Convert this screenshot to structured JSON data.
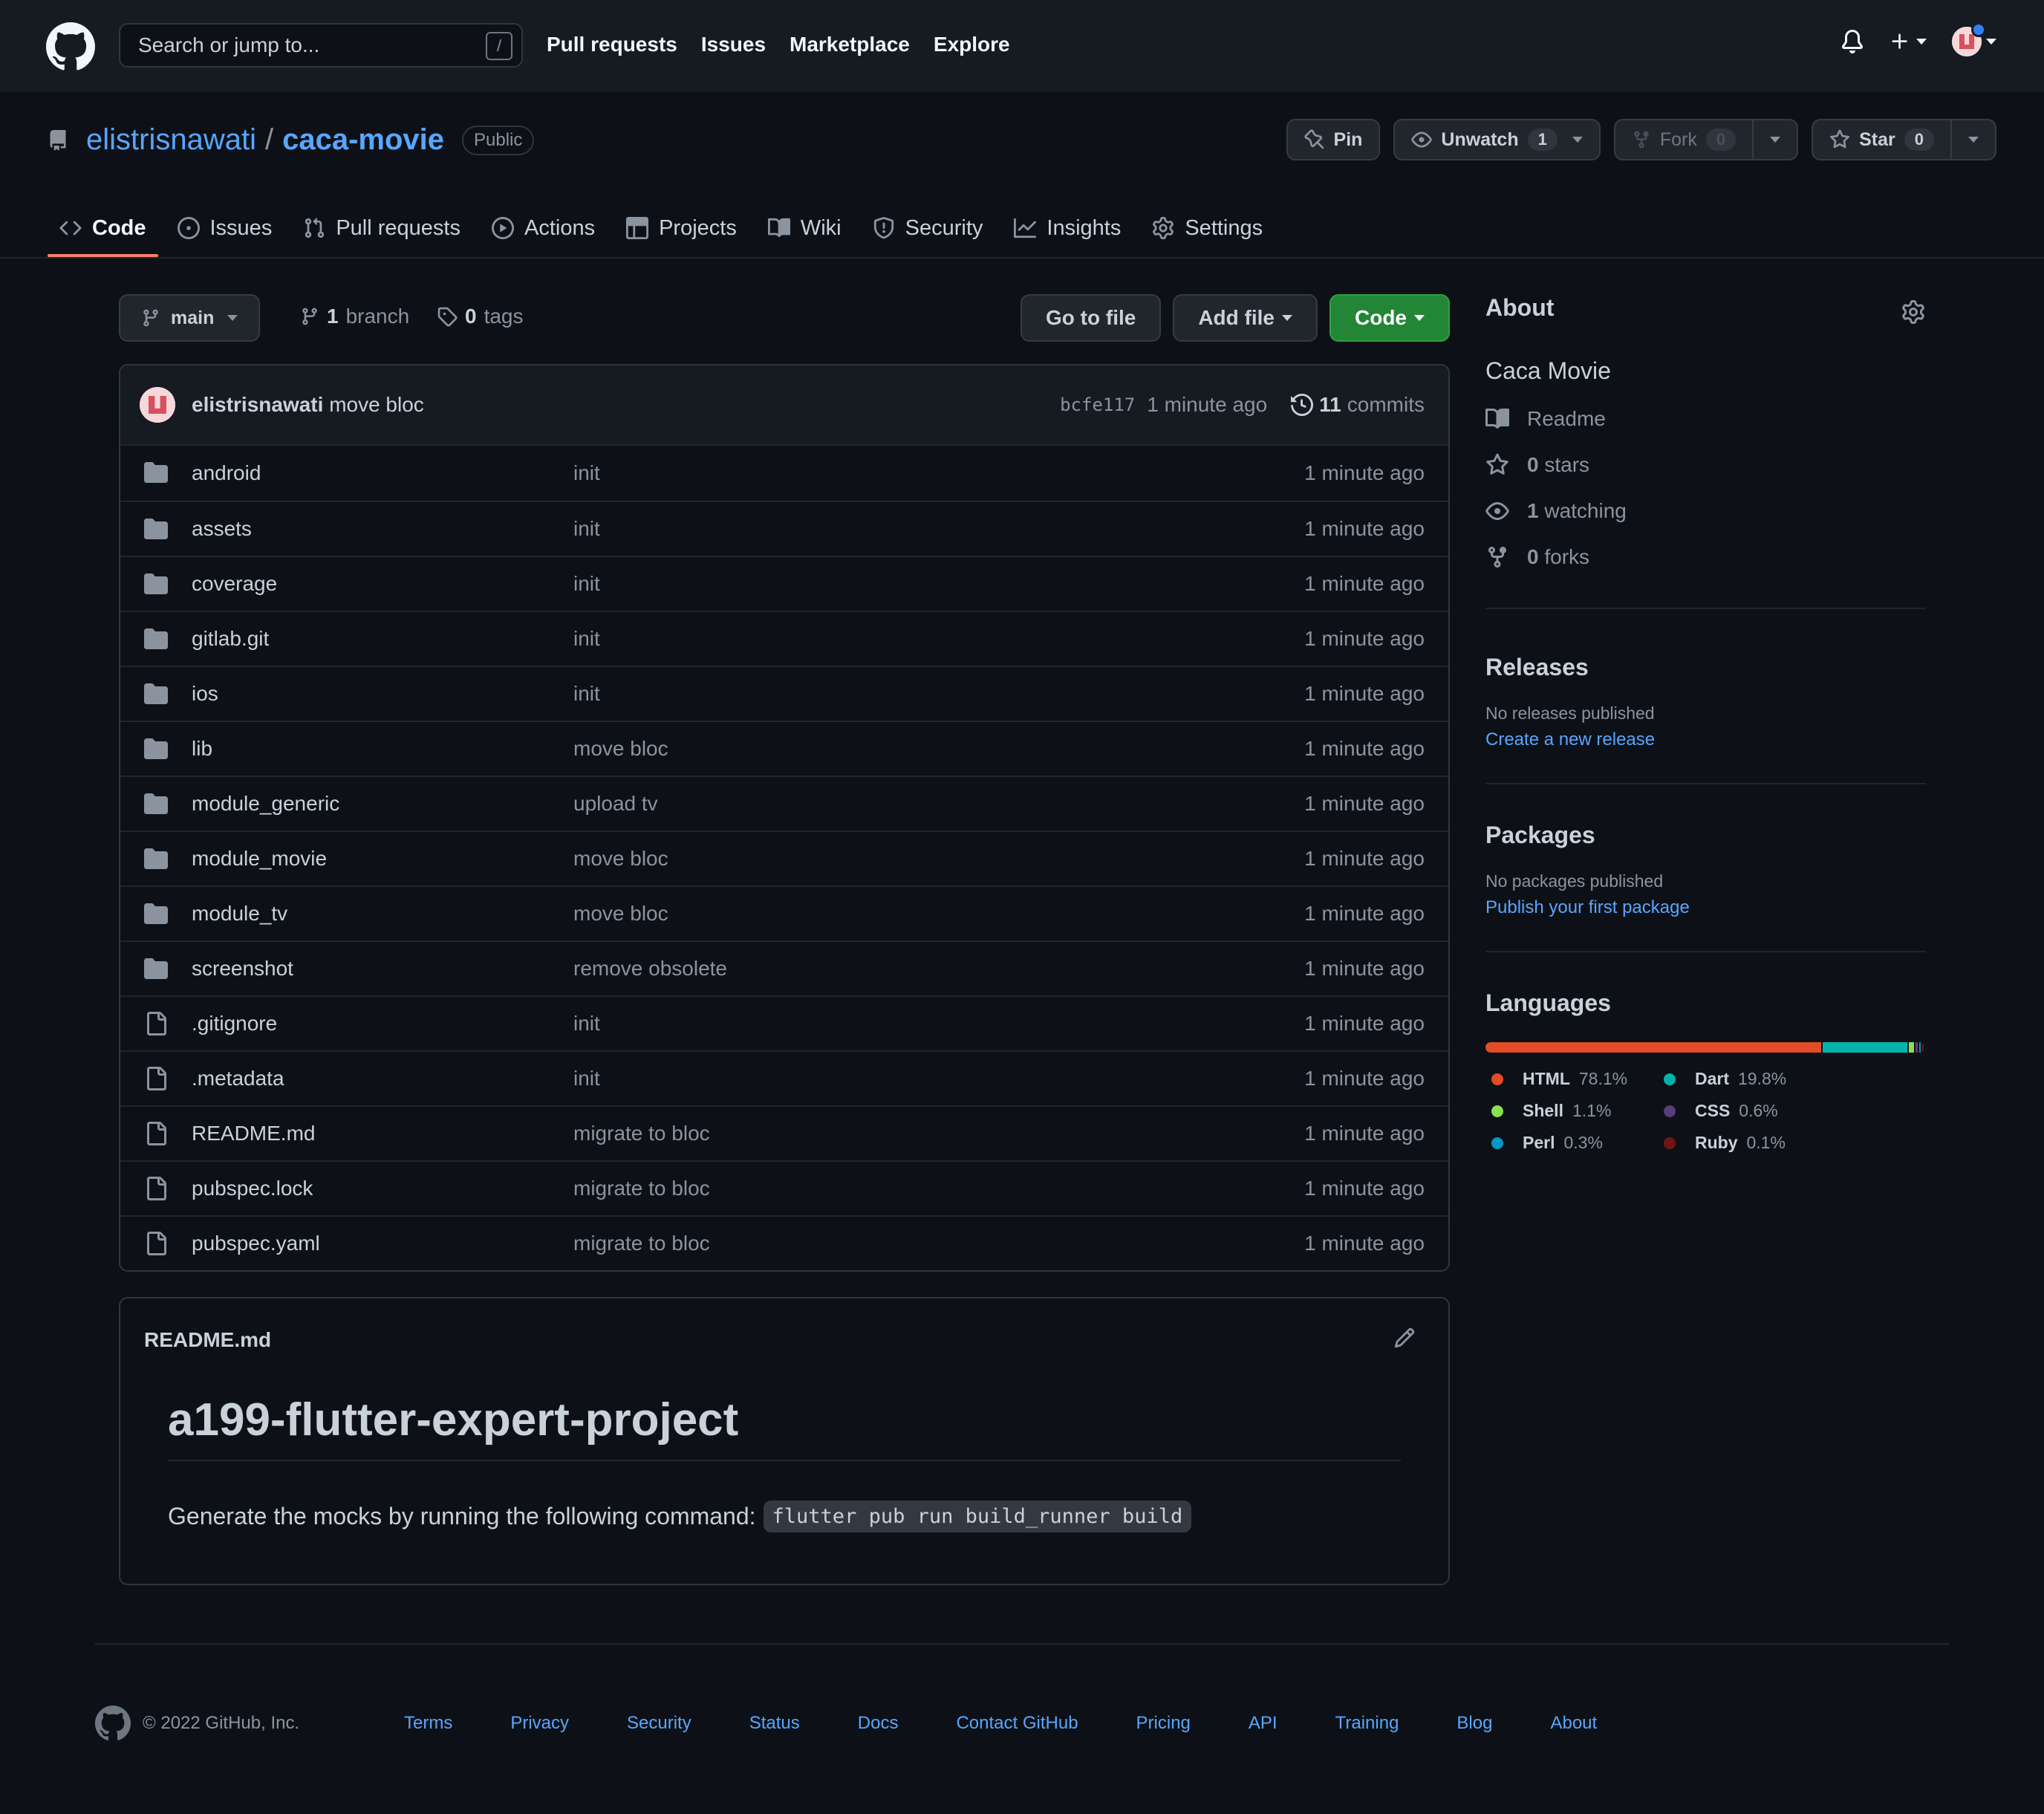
{
  "topbar": {
    "search_placeholder": "Search or jump to...",
    "search_shortcut": "/",
    "nav": [
      "Pull requests",
      "Issues",
      "Marketplace",
      "Explore"
    ]
  },
  "repo": {
    "owner": "elistrisnawati",
    "separator": "/",
    "name": "caca-movie",
    "visibility": "Public",
    "actions": {
      "pin": "Pin",
      "unwatch": "Unwatch",
      "watch_count": "1",
      "fork": "Fork",
      "fork_count": "0",
      "star": "Star",
      "star_count": "0"
    },
    "tabs": [
      "Code",
      "Issues",
      "Pull requests",
      "Actions",
      "Projects",
      "Wiki",
      "Security",
      "Insights",
      "Settings"
    ],
    "active_tab": "Code"
  },
  "toolbar": {
    "branch": "main",
    "branches_count": "1",
    "branches_label": "branch",
    "tags_count": "0",
    "tags_label": "tags",
    "go_to_file": "Go to file",
    "add_file": "Add file",
    "code": "Code"
  },
  "latest_commit": {
    "author": "elistrisnawati",
    "message": "move bloc",
    "sha": "bcfe117",
    "time": "1 minute ago",
    "commits_count": "11",
    "commits_label": "commits"
  },
  "files": [
    {
      "name": "android",
      "type": "dir",
      "message": "init",
      "age": "1 minute ago"
    },
    {
      "name": "assets",
      "type": "dir",
      "message": "init",
      "age": "1 minute ago"
    },
    {
      "name": "coverage",
      "type": "dir",
      "message": "init",
      "age": "1 minute ago"
    },
    {
      "name": "gitlab.git",
      "type": "dir",
      "message": "init",
      "age": "1 minute ago"
    },
    {
      "name": "ios",
      "type": "dir",
      "message": "init",
      "age": "1 minute ago"
    },
    {
      "name": "lib",
      "type": "dir",
      "message": "move bloc",
      "age": "1 minute ago"
    },
    {
      "name": "module_generic",
      "type": "dir",
      "message": "upload tv",
      "age": "1 minute ago"
    },
    {
      "name": "module_movie",
      "type": "dir",
      "message": "move bloc",
      "age": "1 minute ago"
    },
    {
      "name": "module_tv",
      "type": "dir",
      "message": "move bloc",
      "age": "1 minute ago"
    },
    {
      "name": "screenshot",
      "type": "dir",
      "message": "remove obsolete",
      "age": "1 minute ago"
    },
    {
      "name": ".gitignore",
      "type": "file",
      "message": "init",
      "age": "1 minute ago"
    },
    {
      "name": ".metadata",
      "type": "file",
      "message": "init",
      "age": "1 minute ago"
    },
    {
      "name": "README.md",
      "type": "file",
      "message": "migrate to bloc",
      "age": "1 minute ago"
    },
    {
      "name": "pubspec.lock",
      "type": "file",
      "message": "migrate to bloc",
      "age": "1 minute ago"
    },
    {
      "name": "pubspec.yaml",
      "type": "file",
      "message": "migrate to bloc",
      "age": "1 minute ago"
    }
  ],
  "readme": {
    "filename": "README.md",
    "heading": "a199-flutter-expert-project",
    "text": "Generate the mocks by running the following command:",
    "command": "flutter pub run build_runner build"
  },
  "sidebar": {
    "about_title": "About",
    "description": "Caca Movie",
    "readme_label": "Readme",
    "stars_count": "0",
    "stars_label": "stars",
    "watching_count": "1",
    "watching_label": "watching",
    "forks_count": "0",
    "forks_label": "forks",
    "releases_title": "Releases",
    "releases_empty": "No releases published",
    "releases_link": "Create a new release",
    "packages_title": "Packages",
    "packages_empty": "No packages published",
    "packages_link": "Publish your first package",
    "languages_title": "Languages",
    "languages": [
      {
        "name": "HTML",
        "percent": "78.1%",
        "value": 78.1,
        "color": "#e34c26"
      },
      {
        "name": "Dart",
        "percent": "19.8%",
        "value": 19.8,
        "color": "#00B4AB"
      },
      {
        "name": "Shell",
        "percent": "1.1%",
        "value": 1.1,
        "color": "#89e051"
      },
      {
        "name": "CSS",
        "percent": "0.6%",
        "value": 0.6,
        "color": "#563d7c"
      },
      {
        "name": "Perl",
        "percent": "0.3%",
        "value": 0.3,
        "color": "#0298c3"
      },
      {
        "name": "Ruby",
        "percent": "0.1%",
        "value": 0.1,
        "color": "#701516"
      }
    ]
  },
  "footer": {
    "copyright": "© 2022 GitHub, Inc.",
    "links": [
      "Terms",
      "Privacy",
      "Security",
      "Status",
      "Docs",
      "Contact GitHub",
      "Pricing",
      "API",
      "Training",
      "Blog",
      "About"
    ]
  }
}
